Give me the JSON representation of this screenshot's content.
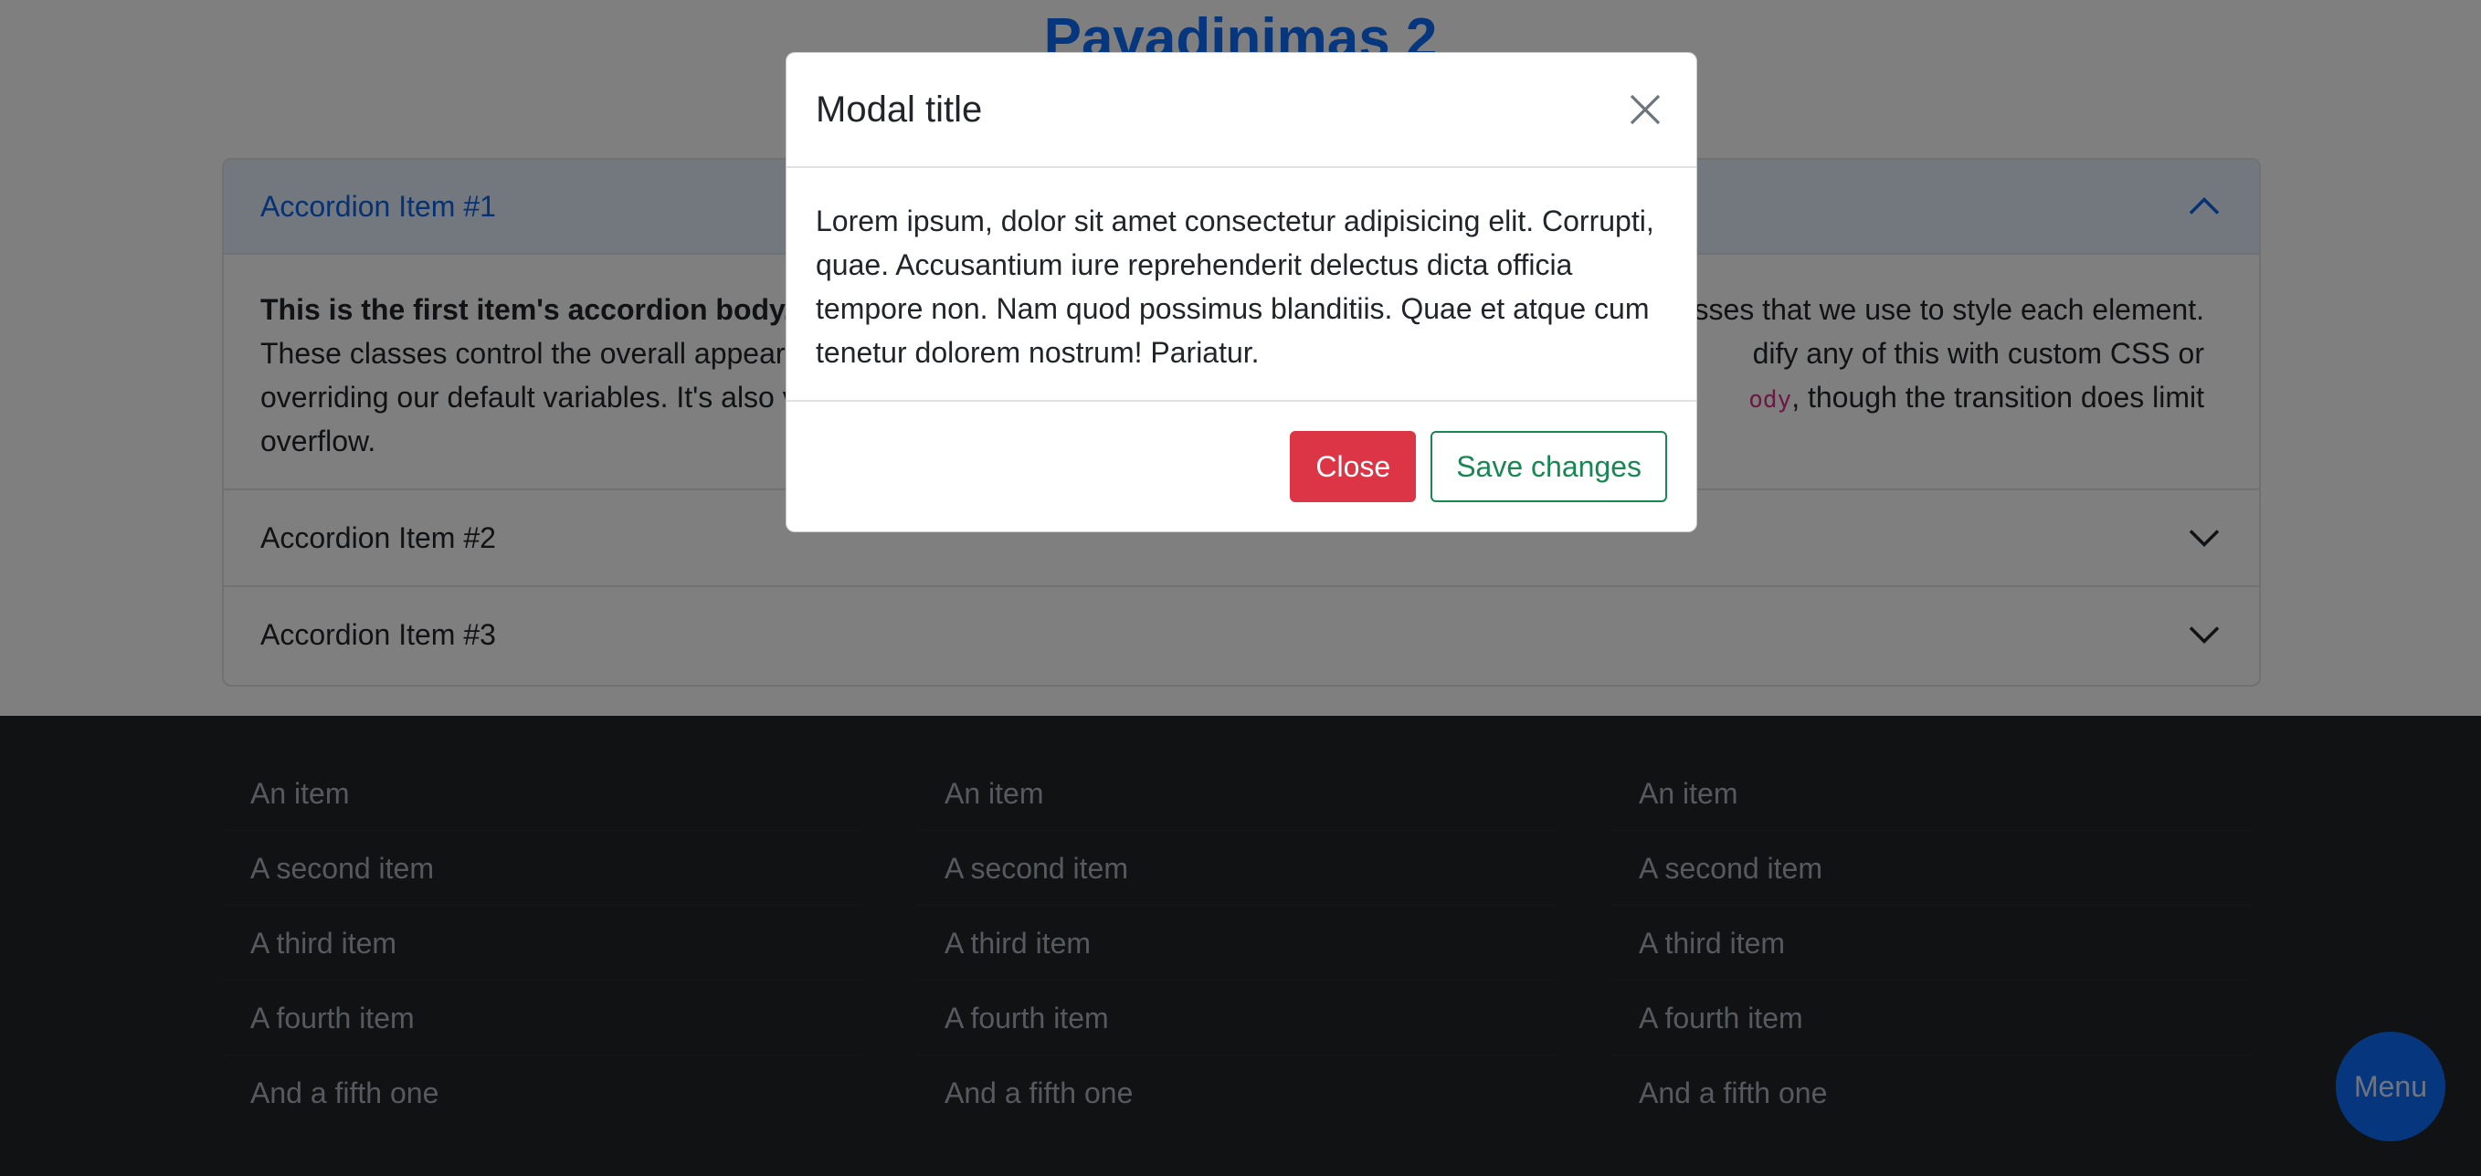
{
  "page": {
    "title": "Pavadinimas 2"
  },
  "accordion": {
    "items": [
      {
        "label": "Accordion Item #1",
        "expanded": true,
        "body_lines": [
          {
            "bold": "This is the first item's accordion body.",
            "rest": ""
          },
          {
            "text_left": "These classes control the overall appeara",
            "text_right": "dify any of this with custom CSS or"
          },
          {
            "text_left": "overriding our default variables. It's also v",
            "code": "ody",
            "text_right": ", though the transition does limit"
          },
          {
            "text_left": "overflow."
          }
        ],
        "body_line1_right": "asses that we use to style each element."
      },
      {
        "label": "Accordion Item #2",
        "expanded": false
      },
      {
        "label": "Accordion Item #3",
        "expanded": false
      }
    ]
  },
  "footer": {
    "columns": [
      [
        "An item",
        "A second item",
        "A third item",
        "A fourth item",
        "And a fifth one"
      ],
      [
        "An item",
        "A second item",
        "A third item",
        "A fourth item",
        "And a fifth one"
      ],
      [
        "An item",
        "A second item",
        "A third item",
        "A fourth item",
        "And a fifth one"
      ]
    ]
  },
  "menu_button": {
    "label": "Menu"
  },
  "modal": {
    "title": "Modal title",
    "body_lines": [
      "Lorem ipsum, dolor sit amet consectetur adipisicing elit. Corrupti,",
      "quae. Accusantium iure reprehenderit delectus dicta officia",
      "tempore non. Nam quod possimus blanditiis. Quae et atque cum",
      "tenetur dolorem nostrum! Pariatur."
    ],
    "close_label": "Close",
    "save_label": "Save changes"
  },
  "colors": {
    "primary": "#0d6efd",
    "danger": "#dc3545",
    "success": "#198754",
    "footer_bg": "#212529"
  }
}
